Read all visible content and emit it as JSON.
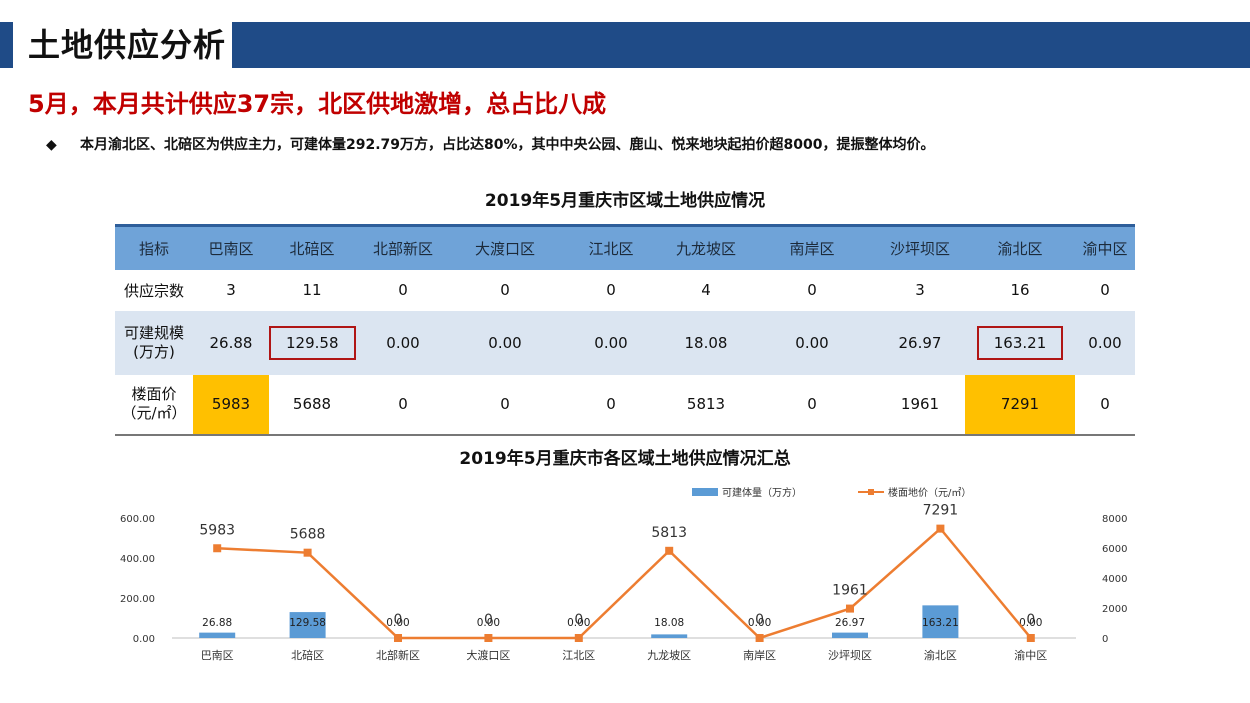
{
  "header": {
    "title": "土地供应分析"
  },
  "subtitle": "5月，本月共计供应37宗，北区供地激增，总占比八成",
  "bullet": {
    "marker": "◆",
    "text": "本月渝北区、北碚区为供应主力，可建体量292.79万方，占比达80%，其中中央公园、鹿山、悦来地块起拍价超8000，提振整体均价。"
  },
  "table": {
    "title": "2019年5月重庆市区域土地供应情况",
    "headers": [
      "指标",
      "巴南区",
      "北碚区",
      "北部新区",
      "大渡口区",
      "江北区",
      "九龙坡区",
      "南岸区",
      "沙坪坝区",
      "渝北区",
      "渝中区"
    ],
    "rows": [
      {
        "label": "供应宗数",
        "values": [
          "3",
          "11",
          "0",
          "0",
          "0",
          "4",
          "0",
          "3",
          "16",
          "0"
        ]
      },
      {
        "label_line1": "可建规模",
        "label_line2": "(万方)",
        "values": [
          "26.88",
          "129.58",
          "0.00",
          "0.00",
          "0.00",
          "18.08",
          "0.00",
          "26.97",
          "163.21",
          "0.00"
        ]
      },
      {
        "label_line1": "楼面价",
        "label_line2": "（元/㎡）",
        "values": [
          "5983",
          "5688",
          "0",
          "0",
          "0",
          "5813",
          "0",
          "1961",
          "7291",
          "0"
        ]
      }
    ]
  },
  "chart_data": {
    "type": "bar+line",
    "title": "2019年5月重庆市各区域土地供应情况汇总",
    "categories": [
      "巴南区",
      "北碚区",
      "北部新区",
      "大渡口区",
      "江北区",
      "九龙坡区",
      "南岸区",
      "沙坪坝区",
      "渝北区",
      "渝中区"
    ],
    "series": [
      {
        "name": "可建体量（万方）",
        "type": "bar",
        "axis": "left",
        "color": "#5b9bd5",
        "values": [
          26.88,
          129.58,
          0,
          0,
          0,
          18.08,
          0,
          26.97,
          163.21,
          0
        ],
        "labels": [
          "26.88",
          "129.58",
          "0.00",
          "0.00",
          "0.00",
          "18.08",
          "0.00",
          "26.97",
          "163.21",
          "0.00"
        ]
      },
      {
        "name": "楼面地价（元/㎡）",
        "type": "line",
        "axis": "right",
        "color": "#ed7d31",
        "values": [
          5983,
          5688,
          0,
          0,
          0,
          5813,
          0,
          1961,
          7291,
          0
        ],
        "labels": [
          "5983",
          "5688",
          "0",
          "0",
          "0",
          "5813",
          "0",
          "1961",
          "7291",
          "0"
        ]
      }
    ],
    "y_left": {
      "ylim": [
        0,
        600
      ],
      "ticks": [
        "0.00",
        "200.00",
        "400.00",
        "600.00"
      ]
    },
    "y_right": {
      "ylim": [
        0,
        8000
      ],
      "ticks": [
        "0",
        "2000",
        "4000",
        "6000",
        "8000"
      ]
    },
    "legend_position": "top-right",
    "grid": false
  }
}
